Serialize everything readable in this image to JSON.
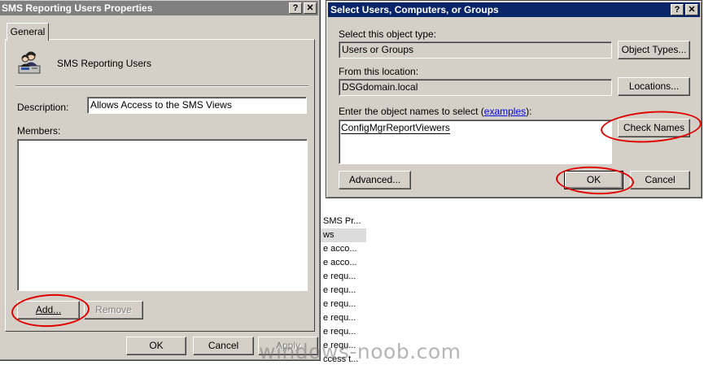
{
  "background_list": [
    "SMS Pr...",
    "ws",
    "e acco...",
    "e acco...",
    "e requ...",
    "e requ...",
    "e requ...",
    "e requ...",
    "e requ...",
    "e requ...",
    "ccess t..."
  ],
  "watermark": "windows-noob.com",
  "props_dialog": {
    "title": "SMS Reporting Users Properties",
    "help_glyph": "?",
    "close_glyph": "✕",
    "tab_general": "General",
    "group_name": "SMS Reporting Users",
    "description_label": "Description:",
    "description_value": "Allows Access to the SMS Views",
    "members_label": "Members:",
    "add_label": "Add...",
    "remove_label": "Remove",
    "ok_label": "OK",
    "cancel_label": "Cancel",
    "apply_label": "Apply"
  },
  "select_dialog": {
    "title": "Select Users, Computers, or Groups",
    "help_glyph": "?",
    "close_glyph": "✕",
    "object_type_label": "Select this object type:",
    "object_type_value": "Users or Groups",
    "object_types_button": "Object Types...",
    "location_label": "From this location:",
    "location_value": "DSGdomain.local",
    "locations_button": "Locations...",
    "names_label": "Enter the object names to select (",
    "names_link": "examples",
    "names_label_end": "):",
    "names_value": "ConfigMgrReportViewers",
    "check_names_button": "Check Names",
    "advanced_button": "Advanced...",
    "ok_button": "OK",
    "cancel_button": "Cancel"
  }
}
